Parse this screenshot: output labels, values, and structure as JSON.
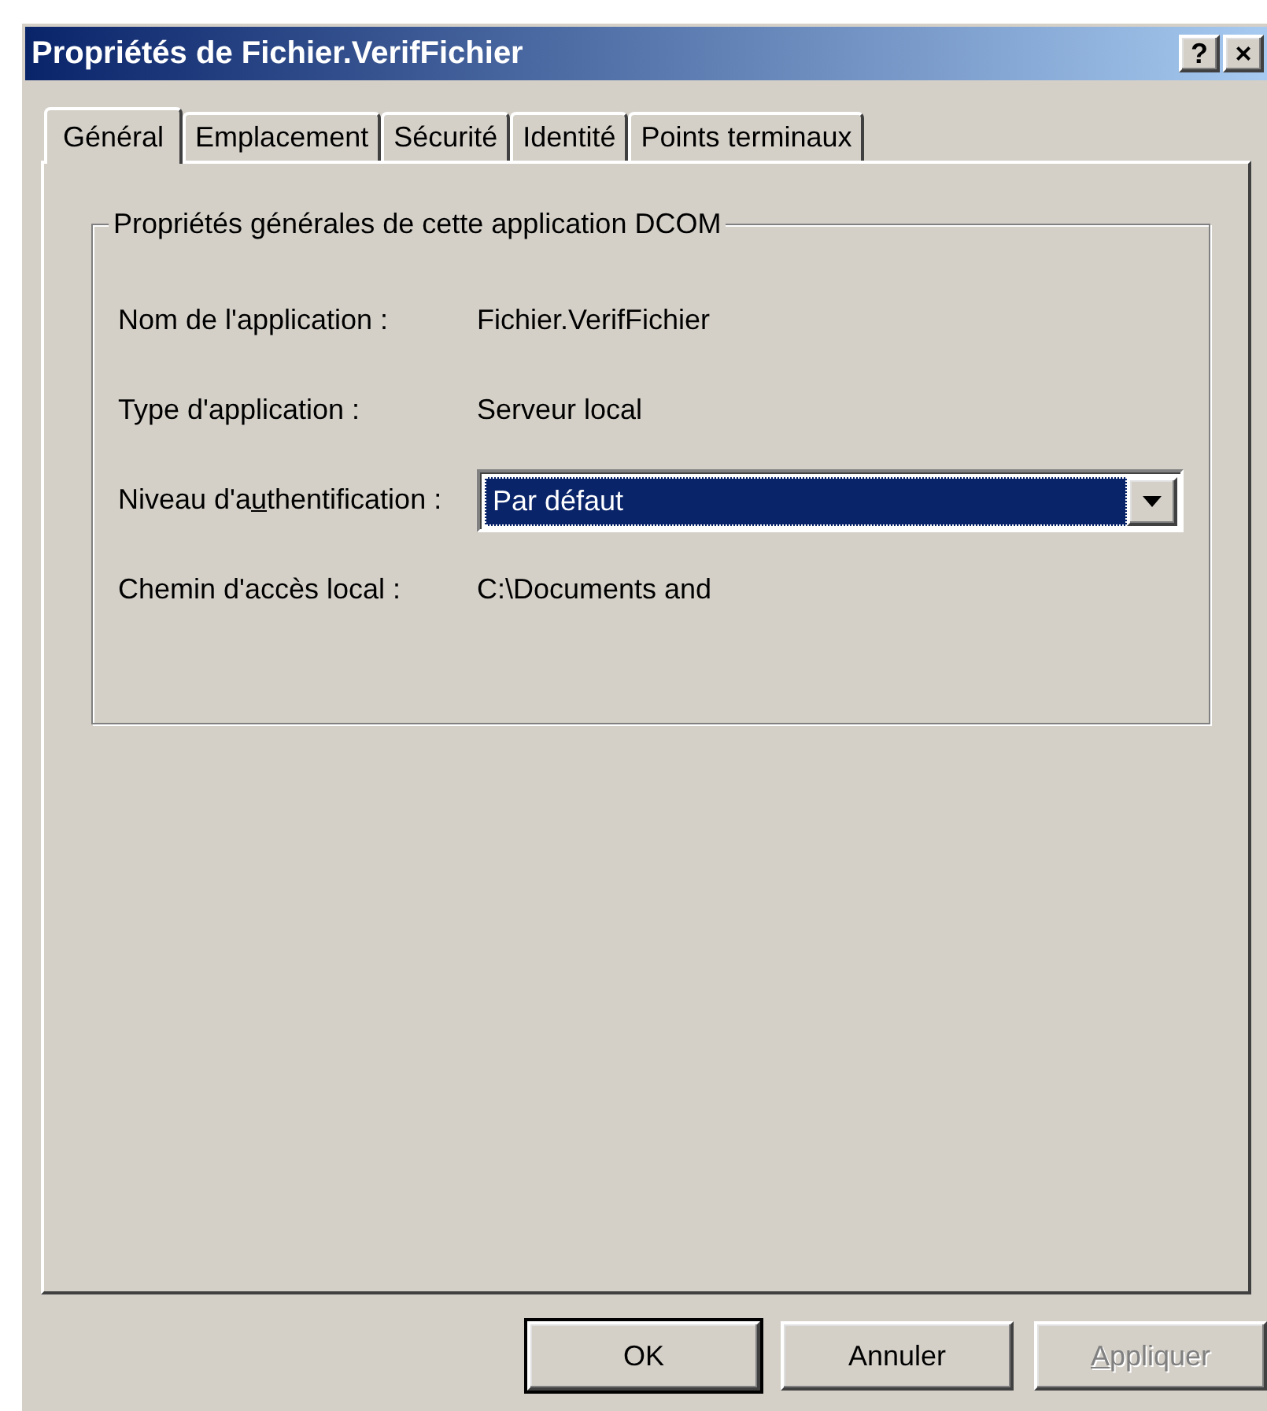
{
  "window": {
    "title": "Propriétés de Fichier.VerifFichier",
    "buttons": [
      "?",
      "×"
    ]
  },
  "tabs": [
    {
      "label": "Général",
      "selected": true
    },
    {
      "label": "Emplacement",
      "selected": false
    },
    {
      "label": "Sécurité",
      "selected": false
    },
    {
      "label": "Identité",
      "selected": false
    },
    {
      "label": "Points terminaux",
      "selected": false
    }
  ],
  "group": {
    "title": "Propriétés générales de cette application DCOM",
    "rows": [
      {
        "kind": "text",
        "label": {
          "text": "Nom de l'application :"
        },
        "value": "Fichier.VerifFichier"
      },
      {
        "kind": "text",
        "label": {
          "text": "Type d'application :"
        },
        "value": "Serveur local"
      },
      {
        "kind": "dropdown",
        "label": {
          "text": "Niveau d'a",
          "access_key": "u",
          "rest": "thentification :"
        },
        "value": "Par défaut"
      },
      {
        "kind": "text",
        "label": {
          "text": "Chemin d'accès local :"
        },
        "value": "C:\\Documents and"
      }
    ]
  },
  "buttons": [
    {
      "label": {
        "text": "OK"
      },
      "default": true,
      "disabled": false
    },
    {
      "label": {
        "text": "Annuler"
      },
      "default": false,
      "disabled": false
    },
    {
      "label": {
        "access_key": "A",
        "rest": "ppliquer"
      },
      "default": false,
      "disabled": true
    }
  ]
}
